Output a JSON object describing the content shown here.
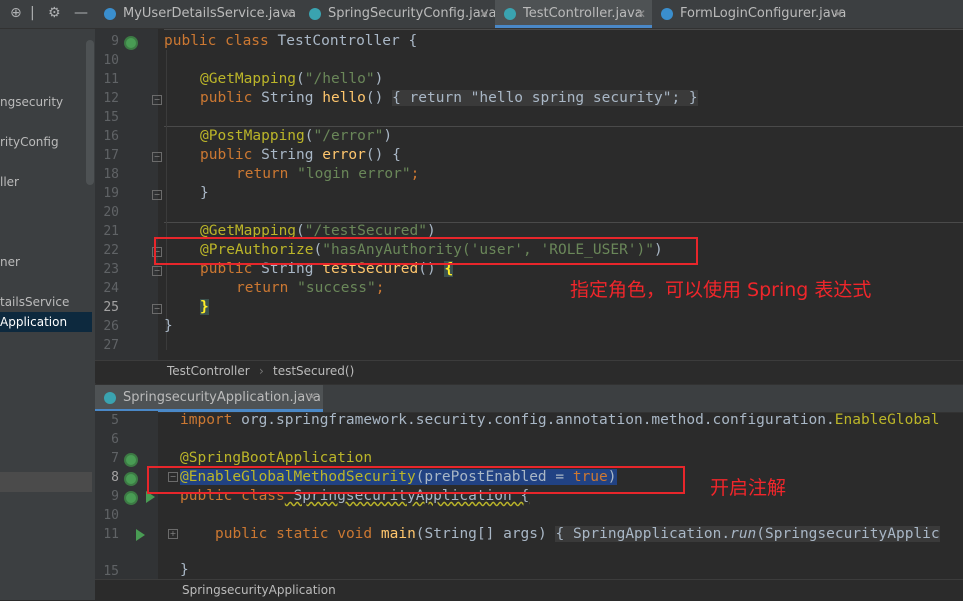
{
  "project_panel": {
    "items": [
      "ngsecurity",
      "rityConfig",
      "ller",
      "ner",
      "tailsService",
      "Application"
    ]
  },
  "tabs": [
    {
      "label": "MyUserDetailsService.java"
    },
    {
      "label": "SpringSecurityConfig.java"
    },
    {
      "label": "TestController.java"
    },
    {
      "label": "FormLoginConfigurer.java"
    }
  ],
  "editor1": {
    "line_numbers": [
      "9",
      "10",
      "11",
      "12",
      "15",
      "16",
      "17",
      "18",
      "19",
      "20",
      "21",
      "22",
      "23",
      "24",
      "25",
      "26",
      "27"
    ],
    "breadcrumb": [
      "TestController",
      "testSecured()"
    ],
    "code": {
      "l9_kw": "public class",
      "l9_rest": " TestController {",
      "l11_ann": "@GetMapping",
      "l11_str": "\"/hello\"",
      "l12_kw": "public",
      "l12_type": " String ",
      "l12_fn": "hello",
      "l12_paren": "() ",
      "l12_fold": "{ return \"hello spring security\"; }",
      "l16_ann": "@PostMapping",
      "l16_str": "\"/error\"",
      "l17_kw": "public",
      "l17_type": " String ",
      "l17_fn": "error",
      "l17_paren": "() {",
      "l18_kw": "return",
      "l18_str": "\"login error\"",
      "l19": "}",
      "l21_ann": "@GetMapping",
      "l21_str": "\"/testSecured\"",
      "l22_ann": "@PreAuthorize",
      "l22_str1": "\"hasAnyAuthority(",
      "l22_str2": "'user'",
      "l22_comma": ", ",
      "l22_str3": "'ROLE_USER'",
      "l22_str4": ")\"",
      "l23_kw": "public",
      "l23_type": " String ",
      "l23_fn": "testSecured",
      "l23_paren": "() ",
      "l23_brace": "{",
      "l24_kw": "return",
      "l24_str": "\"success\"",
      "l25_brace": "}",
      "l26": "}"
    }
  },
  "annotation1": "指定角色，可以使用 Spring 表达式",
  "bottom_tab": {
    "label": "SpringsecurityApplication.java"
  },
  "editor2": {
    "line_numbers": [
      "5",
      "6",
      "7",
      "8",
      "9",
      "10",
      "11",
      "15"
    ],
    "breadcrumb": "SpringsecurityApplication",
    "code": {
      "l5_kw": "import",
      "l5_rest": " org.springframework.security.config.annotation.method.configuration.",
      "l5_cls": "EnableGlobal",
      "l7_ann": "@SpringBootApplication",
      "l8_ann": "@EnableGlobalMethodSecurity",
      "l8_rest": "(prePostEnabled = ",
      "l8_kw": "true",
      "l8_close": ")",
      "l9_kw": "public class",
      "l9_rest": " SpringsecurityApplication {",
      "l11_kw": "public static void",
      "l11_fn": "main",
      "l11_rest": "(String[] args) ",
      "l11_fold": "{ SpringApplication.",
      "l11_it": "run",
      "l11_tail": "(SpringsecurityApplic",
      "l15": "}"
    }
  },
  "annotation2": "开启注解"
}
